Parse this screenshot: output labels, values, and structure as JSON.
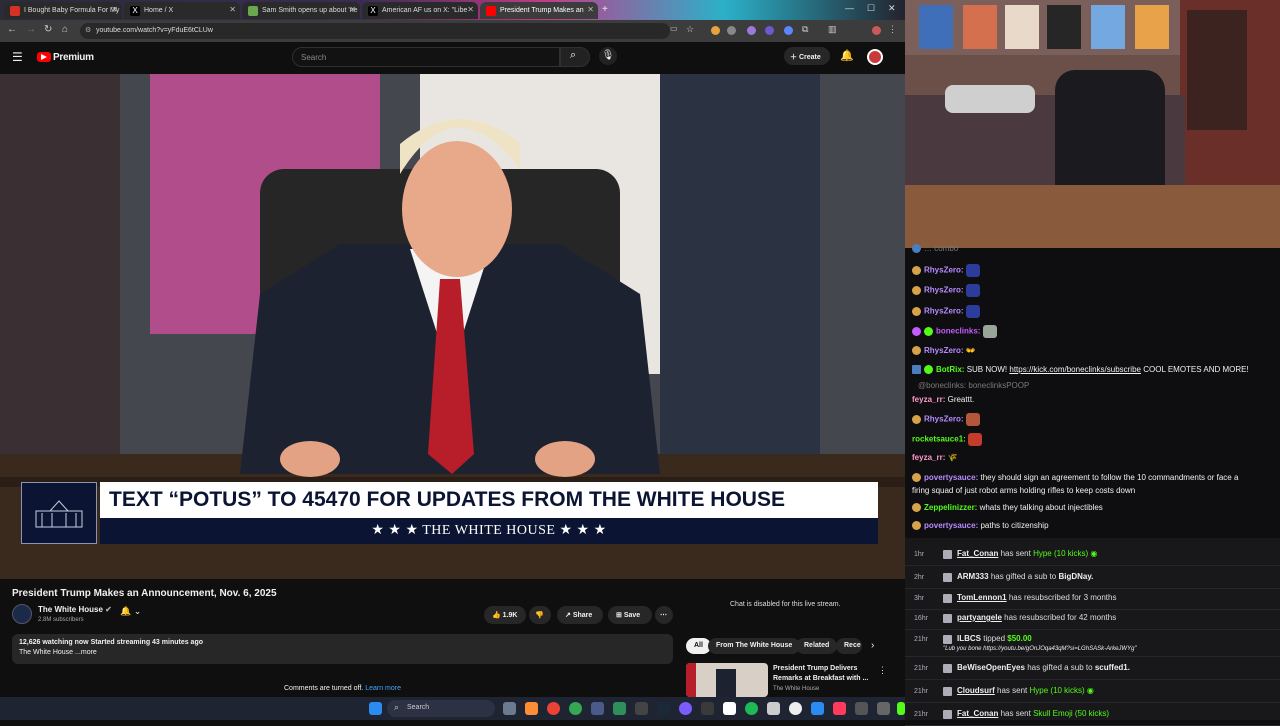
{
  "browser": {
    "tabs": [
      {
        "label": "I Bought Baby Formula For My",
        "color": "#d93025"
      },
      {
        "label": "Home / X",
        "color": "#000000"
      },
      {
        "label": "Sam Smith opens up about 'ne",
        "color": "#6aa84f"
      },
      {
        "label": "American AF us on X: \"Libe",
        "color": "#000000"
      },
      {
        "label": "President Trump Makes an",
        "color": "#ff0000"
      }
    ],
    "url": "youtube.com/watch?v=yFduE6tCLUw"
  },
  "youtube": {
    "logo": "Premium",
    "search_placeholder": "Search",
    "create_label": "Create",
    "banner_text": "TEXT “POTUS” TO 45470 FOR UPDATES FROM THE WHITE HOUSE",
    "banner_sub": "★ ★ ★   THE WHITE HOUSE   ★ ★ ★",
    "video_title": "President Trump Makes an Announcement, Nov. 6, 2025",
    "channel_name": "The White House",
    "subscribers": "2.8M subscribers",
    "likes": "1.9K",
    "share_label": "Share",
    "save_label": "Save",
    "chat_disabled": "Chat is disabled for this live stream.",
    "desc_line1": "12,626 watching now  Started streaming 43 minutes ago",
    "desc_line2": "The White House ...more",
    "comments_off": "Comments are turned off.",
    "learn_more": "Learn more",
    "chips": [
      "All",
      "From The White House",
      "Related",
      "Rece"
    ],
    "related_title": "President Trump Delivers Remarks at Breakfast with ...",
    "related_channel": "The White House"
  },
  "chat": {
    "lines": [
      {
        "user": "RhysZero:",
        "text": "",
        "color": "#b58cff",
        "emote": "#2c3c9a"
      },
      {
        "user": "RhysZero:",
        "text": "",
        "color": "#b58cff",
        "emote": "#2c3c9a"
      },
      {
        "user": "RhysZero:",
        "text": "",
        "color": "#b58cff",
        "emote": "#2c3c9a"
      },
      {
        "user": "boneclinks:",
        "text": "",
        "color": "#c45bff",
        "emote": "#9aa59a"
      },
      {
        "user": "RhysZero:",
        "text": "👐",
        "color": "#b58cff",
        "emote": ""
      },
      {
        "user": "BotRix:",
        "text": "SUB NOW!",
        "color": "#53fc18",
        "link": "https://kick.com/boneclinks/subscribe",
        "after": "COOL EMOTES AND MORE!"
      },
      {
        "user": "@boneclinks:",
        "text": "boneclinksPOOP",
        "color": "#7a7a7a",
        "reply": true
      },
      {
        "user": "feyza_rr:",
        "text": "Greattt.",
        "color": "#ff9acb",
        "emote": ""
      },
      {
        "user": "RhysZero:",
        "text": "",
        "color": "#b58cff",
        "emote": "#b3563a"
      },
      {
        "user": "rocketsauce1:",
        "text": "",
        "color": "#53fc18",
        "emote": "#c33b2b"
      },
      {
        "user": "feyza_rr:",
        "text": "🌾",
        "color": "#ff9acb",
        "emote": ""
      },
      {
        "user": "povertysauce:",
        "text": "they should sign an agreement to follow the 10 commandments or face a",
        "color": "#b58cff",
        "cont": "firing squad of just robot arms holding rifles to keep costs down"
      },
      {
        "user": "Zeppelinizzer:",
        "text": "whats they talking about injectibles",
        "color": "#53fc18",
        "emote": ""
      },
      {
        "user": "povertysauce:",
        "text": "paths to citizenship",
        "color": "#b58cff",
        "emote": ""
      }
    ]
  },
  "events": [
    {
      "time": "1hr",
      "name": "Fat_Conan",
      "text": "has sent",
      "extra": "Hype (10 kicks)",
      "extra_color": "#53fc18"
    },
    {
      "time": "2hr",
      "name": "ARM333",
      "text": "has gifted a sub to",
      "extra": "BigDNay.",
      "extra_color": "#efeff1"
    },
    {
      "time": "3hr",
      "name": "TomLennon1",
      "text": "has resubscribed for 3 months",
      "extra": "",
      "extra_color": "#efeff1"
    },
    {
      "time": "16hr",
      "name": "partyangele",
      "text": "has resubscribed for 42 months",
      "extra": "",
      "extra_color": "#efeff1"
    },
    {
      "time": "21hr",
      "name": "ILBCS",
      "text": "tipped",
      "extra": "$50.00",
      "extra_color": "#53fc18",
      "sub": "\"Lub you bone https://youtu.be/gOnJOqa43qM?si=LGhSASk-ArkeJWYg\""
    },
    {
      "time": "21hr",
      "name": "BeWiseOpenEyes",
      "text": "has gifted a sub to",
      "extra": "scuffed1.",
      "extra_color": "#efeff1"
    },
    {
      "time": "21hr",
      "name": "Cloudsurf",
      "text": "has sent",
      "extra": "Hype (10 kicks)",
      "extra_color": "#53fc18"
    },
    {
      "time": "21hr",
      "name": "Fat_Conan",
      "text": "has sent",
      "extra": "Skull Emoji (50 kicks)",
      "extra_color": "#53fc18"
    }
  ],
  "taskbar": {
    "search": "Search"
  }
}
